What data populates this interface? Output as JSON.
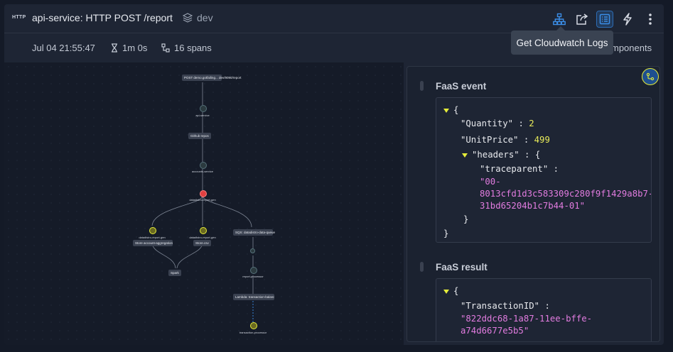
{
  "header": {
    "badge": "HTTP",
    "title": "api-service: HTTP POST /report",
    "env": "dev"
  },
  "toolbar": {
    "icons": [
      "hierarchy-icon",
      "share-icon",
      "cloudwatch-logs-icon",
      "lightning-icon",
      "more-vertical-icon"
    ]
  },
  "subheader": {
    "timestamp": "Jul 04 21:55:47",
    "duration": "1m 0s",
    "spans": "16 spans",
    "components_partial": "mponents"
  },
  "tooltip": "Get Cloudwatch Logs",
  "graph": {
    "nodes": {
      "n1": "POST demo.gotfailing... dev/9090/report",
      "n2": "api-service",
      "n3": "Github repos",
      "n4": "accounts-service",
      "n5": "datadistro-report-gen",
      "n6": "datadistro-report-gen",
      "n6b": "Store account-aggregation...",
      "n7": "datadistro-report-gen",
      "n7b": "Store.csv",
      "n8": "SQS: datadistro-data-queue",
      "n9": "Spark",
      "n10": "report-processor",
      "n11": "Lambda: transaction-balance-cal:TX2989...",
      "n12": "transaction-processor"
    }
  },
  "faas_event": {
    "title": "FaaS event",
    "open": "{",
    "k1": "\"Quantity\"",
    "v1": "2",
    "k2": "\"UnitPrice\"",
    "v2": "499",
    "k3": "\"headers\"",
    "k3_open": "{",
    "k4": "\"traceparent\"",
    "v4a": "\"00-",
    "v4b": "8013cfd1d3c583309c280f9f1429a8b7-",
    "v4c": "31bd65204b1c7b44-01\"",
    "inner_close": "}",
    "close": "}"
  },
  "faas_result": {
    "title": "FaaS result",
    "open": "{",
    "k1": "\"TransactionID\"",
    "v1a": "\"822ddc68-1a87-11ee-bffe-",
    "v1b": "a74d6677e5b5\""
  },
  "colors": {
    "accent": "#3b8ee8",
    "json_string": "#e27ce0",
    "json_number": "#e9ec5a",
    "error_node": "#e04040"
  }
}
